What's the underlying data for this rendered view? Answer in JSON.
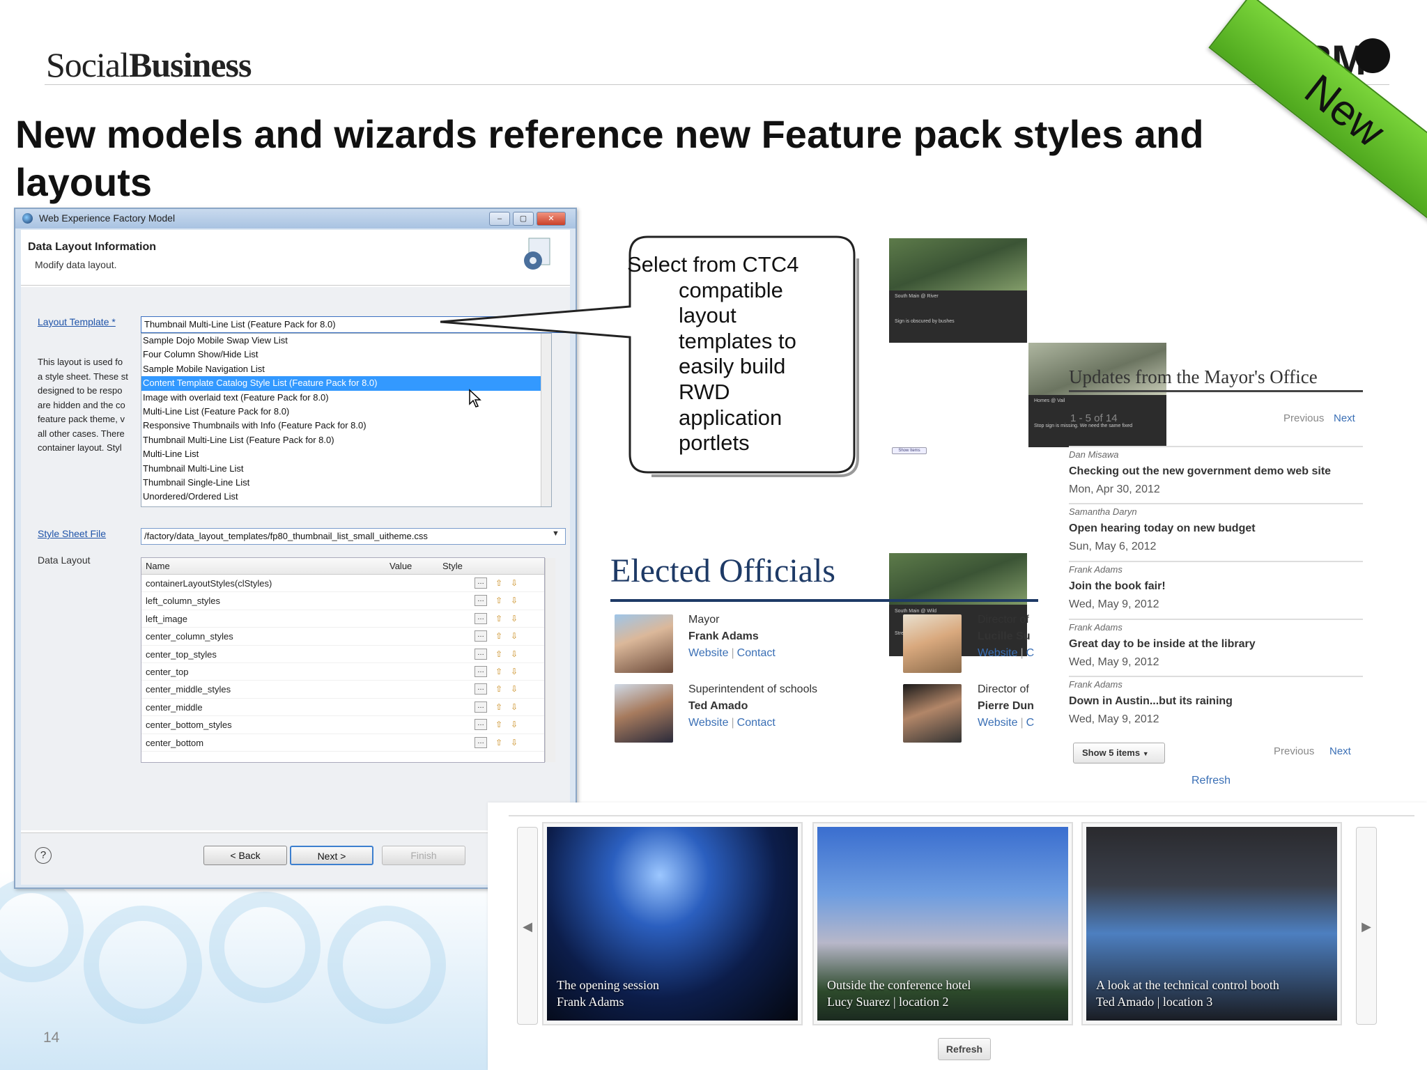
{
  "header": {
    "brand_light": "Social",
    "brand_bold": "Business",
    "logo_text": "IBM",
    "ribbon": "New",
    "title": "New models and wizards reference new Feature pack styles and layouts",
    "page_number": "14"
  },
  "dialog": {
    "window_title": "Web Experience Factory Model",
    "heading": "Data Layout Information",
    "subheading": "Modify data layout.",
    "layout_template_label": "Layout Template *",
    "layout_template_value": "Thumbnail Multi-Line List (Feature Pack for 8.0)",
    "description_lines": [
      "This layout is used fo",
      "a style sheet. These st",
      "designed to be respo",
      "are hidden and the co",
      "feature pack theme, v",
      "all other cases. There",
      "container layout. Styl"
    ],
    "template_options": [
      "Sample Dojo Mobile Swap View List",
      "Four Column Show/Hide List",
      "Sample Mobile Navigation List",
      "Content Template Catalog Style List (Feature Pack for 8.0)",
      "Image with overlaid text (Feature Pack for 8.0)",
      "Multi-Line List (Feature Pack for 8.0)",
      "Responsive Thumbnails with Info (Feature Pack for 8.0)",
      "Thumbnail Multi-Line List (Feature Pack for 8.0)",
      "Multi-Line List",
      "Thumbnail Multi-Line List",
      "Thumbnail Single-Line List",
      "Unordered/Ordered List"
    ],
    "selected_option_index": 3,
    "style_sheet_label": "Style Sheet File",
    "style_sheet_value": "/factory/data_layout_templates/fp80_thumbnail_list_small_uitheme.css",
    "data_layout_label": "Data Layout",
    "table_headers": [
      "Name",
      "Value",
      "Style"
    ],
    "table_rows": [
      "containerLayoutStyles(clStyles)",
      "left_column_styles",
      "left_image",
      "center_column_styles",
      "center_top_styles",
      "center_top",
      "center_middle_styles",
      "center_middle",
      "center_bottom_styles",
      "center_bottom"
    ],
    "buttons": {
      "back": "< Back",
      "next": "Next >",
      "finish": "Finish"
    },
    "help": "?"
  },
  "callout": {
    "line1": "Select from CTC4",
    "lines": [
      "compatible",
      "layout",
      "templates to",
      "easily build",
      "RWD",
      "application",
      "portlets"
    ]
  },
  "thumb_grid": {
    "captions": [
      "South Main @ River",
      "Homes @ Vail",
      "South Main @ Wild"
    ],
    "subcaptions": [
      "Sign is obscured by bushes",
      "Stop sign is missing. We need the same fixed",
      "Street sign is missing"
    ],
    "show_button": "Show Items"
  },
  "elected_officials": {
    "title": "Elected Officials",
    "people": [
      {
        "role": "Mayor",
        "name": "Frank Adams",
        "website": "Website",
        "contact": "Contact"
      },
      {
        "role": "Director of",
        "name": "Lucille Su",
        "website": "Website",
        "contact": "C"
      },
      {
        "role": "Superintendent of schools",
        "name": "Ted Amado",
        "website": "Website",
        "contact": "Contact"
      },
      {
        "role": "Director of",
        "name": "Pierre Dun",
        "website": "Website",
        "contact": "C"
      }
    ]
  },
  "updates": {
    "title": "Updates from the Mayor's Office",
    "range": "1 - 5 of 14",
    "previous": "Previous",
    "next": "Next",
    "items": [
      {
        "author": "Dan Misawa",
        "title": "Checking out the new government demo web site",
        "date": "Mon, Apr 30, 2012"
      },
      {
        "author": "Samantha Daryn",
        "title": "Open hearing today on new budget",
        "date": "Sun, May 6, 2012"
      },
      {
        "author": "Frank Adams",
        "title": "Join the book fair!",
        "date": "Wed, May 9, 2012"
      },
      {
        "author": "Frank Adams",
        "title": "Great day to be inside at the library",
        "date": "Wed, May 9, 2012"
      },
      {
        "author": "Frank Adams",
        "title": "Down in Austin...but its raining",
        "date": "Wed, May 9, 2012"
      }
    ],
    "show_items": "Show 5 items",
    "refresh": "Refresh"
  },
  "carousel": {
    "slides": [
      {
        "title": "The opening session",
        "meta": "Frank Adams"
      },
      {
        "title": "Outside the conference hotel",
        "meta": "Lucy Suarez | location 2"
      },
      {
        "title": "A look at the technical control booth",
        "meta": "Ted Amado | location 3"
      }
    ],
    "refresh": "Refresh"
  }
}
